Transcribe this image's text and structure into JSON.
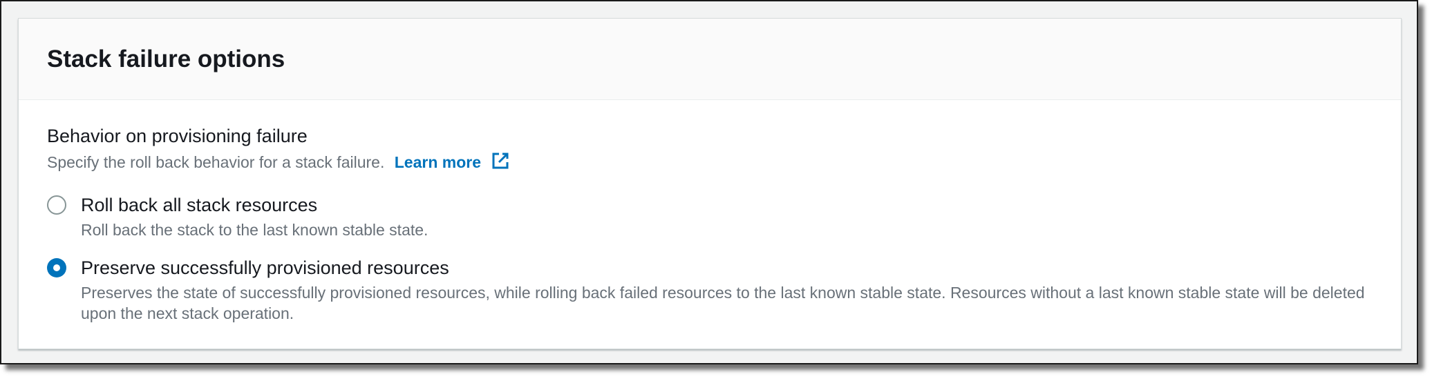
{
  "section": {
    "title": "Stack failure options"
  },
  "field": {
    "label": "Behavior on provisioning failure",
    "description": "Specify the roll back behavior for a stack failure.",
    "learn_more": "Learn more",
    "learn_more_icon": "external-link-icon"
  },
  "options": [
    {
      "label": "Roll back all stack resources",
      "description": "Roll back the stack to the last known stable state.",
      "selected": false
    },
    {
      "label": "Preserve successfully provisioned resources",
      "description": "Preserves the state of successfully provisioned resources, while rolling back failed resources to the last known stable state. Resources without a last known stable state will be deleted upon the next stack operation.",
      "selected": true
    }
  ],
  "colors": {
    "accent": "#0073bb",
    "heading": "#16191f",
    "secondary_text": "#687078",
    "radio_border": "#879596"
  }
}
